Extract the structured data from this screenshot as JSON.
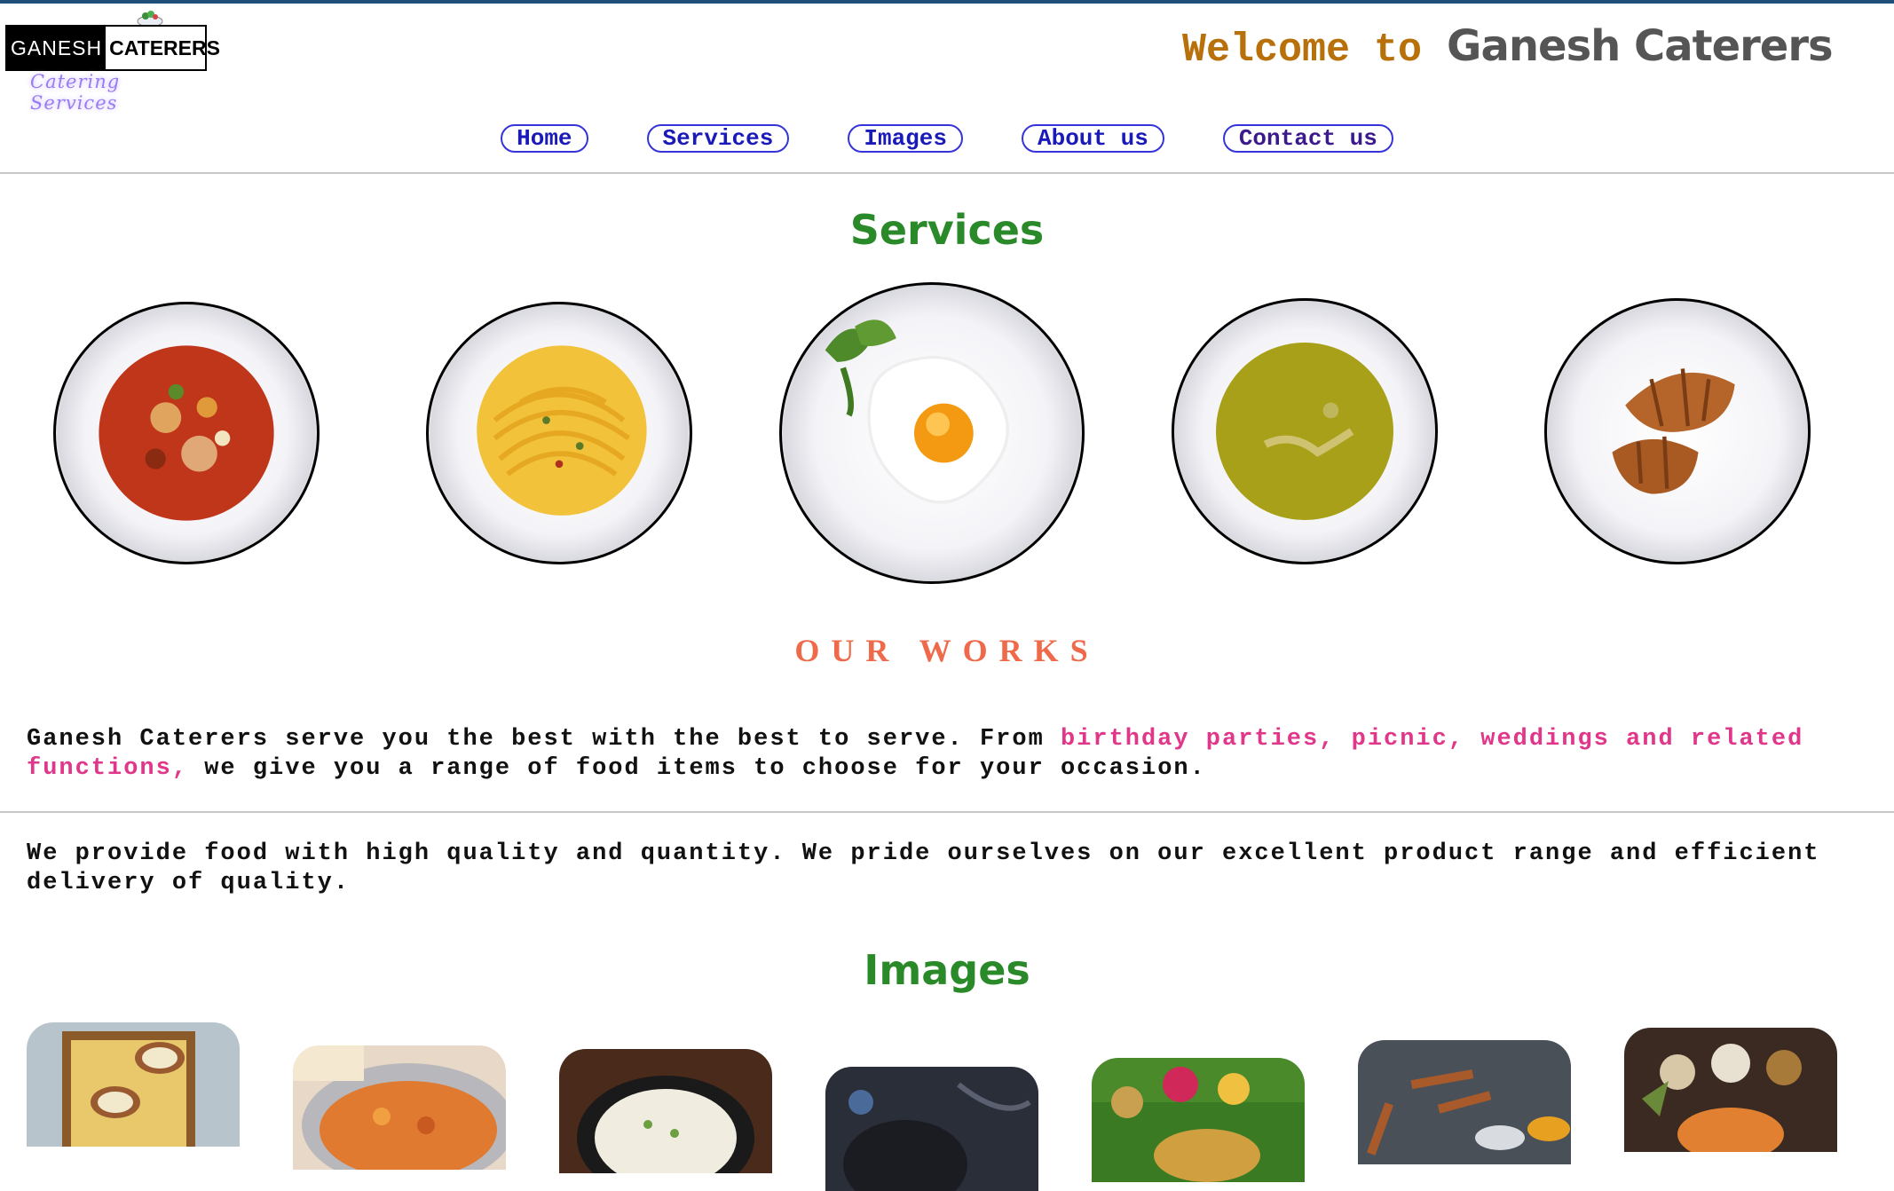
{
  "header": {
    "logo": {
      "part_a": "GANESH",
      "part_b": "CATERERS",
      "tagline": "Catering Services"
    },
    "welcome_prefix": "Welcome to",
    "welcome_name": "Ganesh Caterers"
  },
  "nav": {
    "items": [
      {
        "label": "Home"
      },
      {
        "label": "Services"
      },
      {
        "label": "Images"
      },
      {
        "label": "About us"
      },
      {
        "label": "Contact us"
      }
    ]
  },
  "services": {
    "title": "Services",
    "plates": [
      {
        "icon": "tomato-soup-plate-image"
      },
      {
        "icon": "spaghetti-plate-image"
      },
      {
        "icon": "fried-egg-plate-image"
      },
      {
        "icon": "lentil-soup-plate-image"
      },
      {
        "icon": "croissant-plate-image"
      }
    ]
  },
  "works": {
    "title": "OUR WORKS",
    "p1_start": "Ganesh Caterers serve you the best with the best to serve. From ",
    "p1_highlight": "birthday parties, picnic, weddings and related functions,",
    "p1_end": " we give you a range of food items to choose for your occasion.",
    "p2": "We provide food with high quality and quantity. We pride ourselves on our excellent product range and efficient delivery of quality."
  },
  "images": {
    "title": "Images",
    "items": [
      {
        "icon": "lassi-pots-image"
      },
      {
        "icon": "vegetable-curry-image"
      },
      {
        "icon": "rice-bowl-image"
      },
      {
        "icon": "dark-pan-image"
      },
      {
        "icon": "banana-leaf-meal-image"
      },
      {
        "icon": "spices-image"
      },
      {
        "icon": "spice-platter-image"
      }
    ]
  },
  "colors": {
    "welcome_prefix": "#b8700a",
    "section_title": "#2a8a2a",
    "works_title": "#ef6a4a",
    "highlight": "#e0378a",
    "nav_border": "#3434d8"
  }
}
